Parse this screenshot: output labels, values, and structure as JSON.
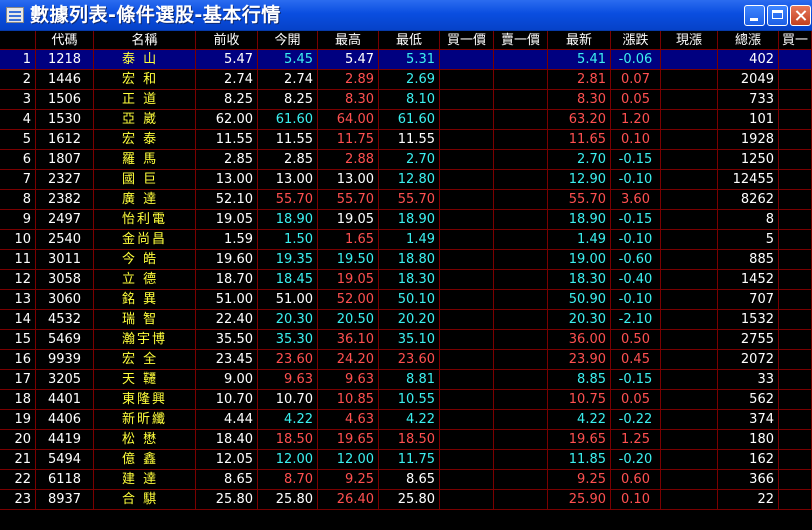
{
  "window": {
    "title": "數據列表-條件選股-基本行情"
  },
  "columns": [
    "",
    "代碼",
    "名稱",
    "前收",
    "今開",
    "最高",
    "最低",
    "買一價",
    "賣一價",
    "最新",
    "漲跌",
    "現漲",
    "總漲",
    "買一"
  ],
  "rows": [
    {
      "no": "1",
      "code": "1218",
      "name": "泰 山",
      "prev": "5.47",
      "open": "5.45",
      "high": "5.47",
      "low": "5.31",
      "bid": "",
      "ask": "",
      "last": "5.41",
      "chg": "-0.06",
      "cur": "",
      "vol": "402",
      "o": "down",
      "h": "flat",
      "l": "down",
      "la": "down"
    },
    {
      "no": "2",
      "code": "1446",
      "name": "宏 和",
      "prev": "2.74",
      "open": "2.74",
      "high": "2.89",
      "low": "2.69",
      "bid": "",
      "ask": "",
      "last": "2.81",
      "chg": "0.07",
      "cur": "",
      "vol": "2049",
      "o": "flat",
      "h": "up",
      "l": "down",
      "la": "up"
    },
    {
      "no": "3",
      "code": "1506",
      "name": "正 道",
      "prev": "8.25",
      "open": "8.25",
      "high": "8.30",
      "low": "8.10",
      "bid": "",
      "ask": "",
      "last": "8.30",
      "chg": "0.05",
      "cur": "",
      "vol": "733",
      "o": "flat",
      "h": "up",
      "l": "down",
      "la": "up"
    },
    {
      "no": "4",
      "code": "1530",
      "name": "亞 崴",
      "prev": "62.00",
      "open": "61.60",
      "high": "64.00",
      "low": "61.60",
      "bid": "",
      "ask": "",
      "last": "63.20",
      "chg": "1.20",
      "cur": "",
      "vol": "101",
      "o": "down",
      "h": "up",
      "l": "down",
      "la": "up"
    },
    {
      "no": "5",
      "code": "1612",
      "name": "宏 泰",
      "prev": "11.55",
      "open": "11.55",
      "high": "11.75",
      "low": "11.55",
      "bid": "",
      "ask": "",
      "last": "11.65",
      "chg": "0.10",
      "cur": "",
      "vol": "1928",
      "o": "flat",
      "h": "up",
      "l": "flat",
      "la": "up"
    },
    {
      "no": "6",
      "code": "1807",
      "name": "羅 馬",
      "prev": "2.85",
      "open": "2.85",
      "high": "2.88",
      "low": "2.70",
      "bid": "",
      "ask": "",
      "last": "2.70",
      "chg": "-0.15",
      "cur": "",
      "vol": "1250",
      "o": "flat",
      "h": "up",
      "l": "down",
      "la": "down"
    },
    {
      "no": "7",
      "code": "2327",
      "name": "國 巨",
      "prev": "13.00",
      "open": "13.00",
      "high": "13.00",
      "low": "12.80",
      "bid": "",
      "ask": "",
      "last": "12.90",
      "chg": "-0.10",
      "cur": "",
      "vol": "12455",
      "o": "flat",
      "h": "flat",
      "l": "down",
      "la": "down"
    },
    {
      "no": "8",
      "code": "2382",
      "name": "廣 達",
      "prev": "52.10",
      "open": "55.70",
      "high": "55.70",
      "low": "55.70",
      "bid": "",
      "ask": "",
      "last": "55.70",
      "chg": "3.60",
      "cur": "",
      "vol": "8262",
      "o": "up",
      "h": "up",
      "l": "up",
      "la": "up"
    },
    {
      "no": "9",
      "code": "2497",
      "name": "怡利電",
      "prev": "19.05",
      "open": "18.90",
      "high": "19.05",
      "low": "18.90",
      "bid": "",
      "ask": "",
      "last": "18.90",
      "chg": "-0.15",
      "cur": "",
      "vol": "8",
      "o": "down",
      "h": "flat",
      "l": "down",
      "la": "down"
    },
    {
      "no": "10",
      "code": "2540",
      "name": "金尚昌",
      "prev": "1.59",
      "open": "1.50",
      "high": "1.65",
      "low": "1.49",
      "bid": "",
      "ask": "",
      "last": "1.49",
      "chg": "-0.10",
      "cur": "",
      "vol": "5",
      "o": "down",
      "h": "up",
      "l": "down",
      "la": "down"
    },
    {
      "no": "11",
      "code": "3011",
      "name": "今 皓",
      "prev": "19.60",
      "open": "19.35",
      "high": "19.50",
      "low": "18.80",
      "bid": "",
      "ask": "",
      "last": "19.00",
      "chg": "-0.60",
      "cur": "",
      "vol": "885",
      "o": "down",
      "h": "down",
      "l": "down",
      "la": "down"
    },
    {
      "no": "12",
      "code": "3058",
      "name": "立 德",
      "prev": "18.70",
      "open": "18.45",
      "high": "19.05",
      "low": "18.30",
      "bid": "",
      "ask": "",
      "last": "18.30",
      "chg": "-0.40",
      "cur": "",
      "vol": "1452",
      "o": "down",
      "h": "up",
      "l": "down",
      "la": "down"
    },
    {
      "no": "13",
      "code": "3060",
      "name": "銘 異",
      "prev": "51.00",
      "open": "51.00",
      "high": "52.00",
      "low": "50.10",
      "bid": "",
      "ask": "",
      "last": "50.90",
      "chg": "-0.10",
      "cur": "",
      "vol": "707",
      "o": "flat",
      "h": "up",
      "l": "down",
      "la": "down"
    },
    {
      "no": "14",
      "code": "4532",
      "name": "瑞 智",
      "prev": "22.40",
      "open": "20.30",
      "high": "20.50",
      "low": "20.20",
      "bid": "",
      "ask": "",
      "last": "20.30",
      "chg": "-2.10",
      "cur": "",
      "vol": "1532",
      "o": "down",
      "h": "down",
      "l": "down",
      "la": "down"
    },
    {
      "no": "15",
      "code": "5469",
      "name": "瀚宇博",
      "prev": "35.50",
      "open": "35.30",
      "high": "36.10",
      "low": "35.10",
      "bid": "",
      "ask": "",
      "last": "36.00",
      "chg": "0.50",
      "cur": "",
      "vol": "2755",
      "o": "down",
      "h": "up",
      "l": "down",
      "la": "up"
    },
    {
      "no": "16",
      "code": "9939",
      "name": "宏 全",
      "prev": "23.45",
      "open": "23.60",
      "high": "24.20",
      "low": "23.60",
      "bid": "",
      "ask": "",
      "last": "23.90",
      "chg": "0.45",
      "cur": "",
      "vol": "2072",
      "o": "up",
      "h": "up",
      "l": "up",
      "la": "up"
    },
    {
      "no": "17",
      "code": "3205",
      "name": "天 韆",
      "prev": "9.00",
      "open": "9.63",
      "high": "9.63",
      "low": "8.81",
      "bid": "",
      "ask": "",
      "last": "8.85",
      "chg": "-0.15",
      "cur": "",
      "vol": "33",
      "o": "up",
      "h": "up",
      "l": "down",
      "la": "down"
    },
    {
      "no": "18",
      "code": "4401",
      "name": "東隆興",
      "prev": "10.70",
      "open": "10.70",
      "high": "10.85",
      "low": "10.55",
      "bid": "",
      "ask": "",
      "last": "10.75",
      "chg": "0.05",
      "cur": "",
      "vol": "562",
      "o": "flat",
      "h": "up",
      "l": "down",
      "la": "up"
    },
    {
      "no": "19",
      "code": "4406",
      "name": "新昕纖",
      "prev": "4.44",
      "open": "4.22",
      "high": "4.63",
      "low": "4.22",
      "bid": "",
      "ask": "",
      "last": "4.22",
      "chg": "-0.22",
      "cur": "",
      "vol": "374",
      "o": "down",
      "h": "up",
      "l": "down",
      "la": "down"
    },
    {
      "no": "20",
      "code": "4419",
      "name": "松 懋",
      "prev": "18.40",
      "open": "18.50",
      "high": "19.65",
      "low": "18.50",
      "bid": "",
      "ask": "",
      "last": "19.65",
      "chg": "1.25",
      "cur": "",
      "vol": "180",
      "o": "up",
      "h": "up",
      "l": "up",
      "la": "up"
    },
    {
      "no": "21",
      "code": "5494",
      "name": "億 鑫",
      "prev": "12.05",
      "open": "12.00",
      "high": "12.00",
      "low": "11.75",
      "bid": "",
      "ask": "",
      "last": "11.85",
      "chg": "-0.20",
      "cur": "",
      "vol": "162",
      "o": "down",
      "h": "down",
      "l": "down",
      "la": "down"
    },
    {
      "no": "22",
      "code": "6118",
      "name": "建 達",
      "prev": "8.65",
      "open": "8.70",
      "high": "9.25",
      "low": "8.65",
      "bid": "",
      "ask": "",
      "last": "9.25",
      "chg": "0.60",
      "cur": "",
      "vol": "366",
      "o": "up",
      "h": "up",
      "l": "flat",
      "la": "up"
    },
    {
      "no": "23",
      "code": "8937",
      "name": "合 騏",
      "prev": "25.80",
      "open": "25.80",
      "high": "26.40",
      "low": "25.80",
      "bid": "",
      "ask": "",
      "last": "25.90",
      "chg": "0.10",
      "cur": "",
      "vol": "22",
      "o": "flat",
      "h": "up",
      "l": "flat",
      "la": "up"
    }
  ],
  "colors": {
    "up": "#ff5050",
    "down": "#3cf0f0",
    "flat": "#ffffff",
    "grid_line": "#7a0000",
    "selected_row": "#000080"
  }
}
